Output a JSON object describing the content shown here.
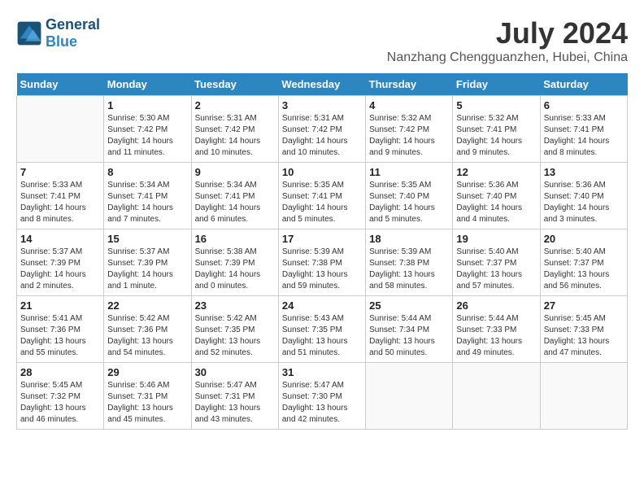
{
  "header": {
    "logo_line1": "General",
    "logo_line2": "Blue",
    "month_year": "July 2024",
    "location": "Nanzhang Chengguanzhen, Hubei, China"
  },
  "weekdays": [
    "Sunday",
    "Monday",
    "Tuesday",
    "Wednesday",
    "Thursday",
    "Friday",
    "Saturday"
  ],
  "weeks": [
    [
      {
        "day": null,
        "info": null
      },
      {
        "day": "1",
        "info": "Sunrise: 5:30 AM\nSunset: 7:42 PM\nDaylight: 14 hours\nand 11 minutes."
      },
      {
        "day": "2",
        "info": "Sunrise: 5:31 AM\nSunset: 7:42 PM\nDaylight: 14 hours\nand 10 minutes."
      },
      {
        "day": "3",
        "info": "Sunrise: 5:31 AM\nSunset: 7:42 PM\nDaylight: 14 hours\nand 10 minutes."
      },
      {
        "day": "4",
        "info": "Sunrise: 5:32 AM\nSunset: 7:42 PM\nDaylight: 14 hours\nand 9 minutes."
      },
      {
        "day": "5",
        "info": "Sunrise: 5:32 AM\nSunset: 7:41 PM\nDaylight: 14 hours\nand 9 minutes."
      },
      {
        "day": "6",
        "info": "Sunrise: 5:33 AM\nSunset: 7:41 PM\nDaylight: 14 hours\nand 8 minutes."
      }
    ],
    [
      {
        "day": "7",
        "info": "Sunrise: 5:33 AM\nSunset: 7:41 PM\nDaylight: 14 hours\nand 8 minutes."
      },
      {
        "day": "8",
        "info": "Sunrise: 5:34 AM\nSunset: 7:41 PM\nDaylight: 14 hours\nand 7 minutes."
      },
      {
        "day": "9",
        "info": "Sunrise: 5:34 AM\nSunset: 7:41 PM\nDaylight: 14 hours\nand 6 minutes."
      },
      {
        "day": "10",
        "info": "Sunrise: 5:35 AM\nSunset: 7:41 PM\nDaylight: 14 hours\nand 5 minutes."
      },
      {
        "day": "11",
        "info": "Sunrise: 5:35 AM\nSunset: 7:40 PM\nDaylight: 14 hours\nand 5 minutes."
      },
      {
        "day": "12",
        "info": "Sunrise: 5:36 AM\nSunset: 7:40 PM\nDaylight: 14 hours\nand 4 minutes."
      },
      {
        "day": "13",
        "info": "Sunrise: 5:36 AM\nSunset: 7:40 PM\nDaylight: 14 hours\nand 3 minutes."
      }
    ],
    [
      {
        "day": "14",
        "info": "Sunrise: 5:37 AM\nSunset: 7:39 PM\nDaylight: 14 hours\nand 2 minutes."
      },
      {
        "day": "15",
        "info": "Sunrise: 5:37 AM\nSunset: 7:39 PM\nDaylight: 14 hours\nand 1 minute."
      },
      {
        "day": "16",
        "info": "Sunrise: 5:38 AM\nSunset: 7:39 PM\nDaylight: 14 hours\nand 0 minutes."
      },
      {
        "day": "17",
        "info": "Sunrise: 5:39 AM\nSunset: 7:38 PM\nDaylight: 13 hours\nand 59 minutes."
      },
      {
        "day": "18",
        "info": "Sunrise: 5:39 AM\nSunset: 7:38 PM\nDaylight: 13 hours\nand 58 minutes."
      },
      {
        "day": "19",
        "info": "Sunrise: 5:40 AM\nSunset: 7:37 PM\nDaylight: 13 hours\nand 57 minutes."
      },
      {
        "day": "20",
        "info": "Sunrise: 5:40 AM\nSunset: 7:37 PM\nDaylight: 13 hours\nand 56 minutes."
      }
    ],
    [
      {
        "day": "21",
        "info": "Sunrise: 5:41 AM\nSunset: 7:36 PM\nDaylight: 13 hours\nand 55 minutes."
      },
      {
        "day": "22",
        "info": "Sunrise: 5:42 AM\nSunset: 7:36 PM\nDaylight: 13 hours\nand 54 minutes."
      },
      {
        "day": "23",
        "info": "Sunrise: 5:42 AM\nSunset: 7:35 PM\nDaylight: 13 hours\nand 52 minutes."
      },
      {
        "day": "24",
        "info": "Sunrise: 5:43 AM\nSunset: 7:35 PM\nDaylight: 13 hours\nand 51 minutes."
      },
      {
        "day": "25",
        "info": "Sunrise: 5:44 AM\nSunset: 7:34 PM\nDaylight: 13 hours\nand 50 minutes."
      },
      {
        "day": "26",
        "info": "Sunrise: 5:44 AM\nSunset: 7:33 PM\nDaylight: 13 hours\nand 49 minutes."
      },
      {
        "day": "27",
        "info": "Sunrise: 5:45 AM\nSunset: 7:33 PM\nDaylight: 13 hours\nand 47 minutes."
      }
    ],
    [
      {
        "day": "28",
        "info": "Sunrise: 5:45 AM\nSunset: 7:32 PM\nDaylight: 13 hours\nand 46 minutes."
      },
      {
        "day": "29",
        "info": "Sunrise: 5:46 AM\nSunset: 7:31 PM\nDaylight: 13 hours\nand 45 minutes."
      },
      {
        "day": "30",
        "info": "Sunrise: 5:47 AM\nSunset: 7:31 PM\nDaylight: 13 hours\nand 43 minutes."
      },
      {
        "day": "31",
        "info": "Sunrise: 5:47 AM\nSunset: 7:30 PM\nDaylight: 13 hours\nand 42 minutes."
      },
      {
        "day": null,
        "info": null
      },
      {
        "day": null,
        "info": null
      },
      {
        "day": null,
        "info": null
      }
    ]
  ]
}
